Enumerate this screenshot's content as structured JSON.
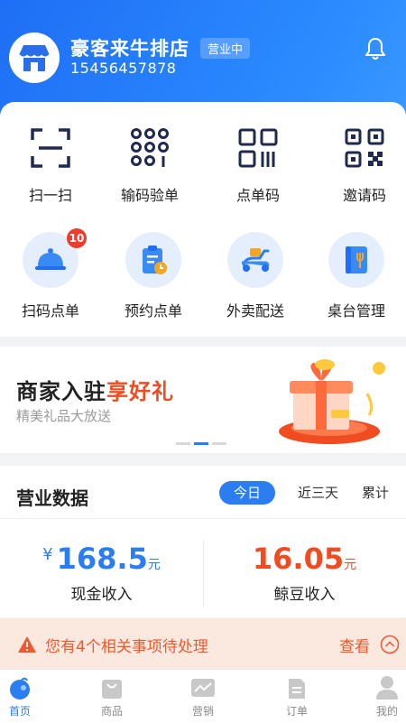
{
  "colors": {
    "primary": "#2b7ef2",
    "accent": "#f04c22",
    "notice_bg": "#fbe9e0"
  },
  "header": {
    "store_name": "豪客来牛排店",
    "status": "营业中",
    "phone": "15456457878",
    "avatar_icon": "storefront-icon",
    "bell_icon": "bell-icon"
  },
  "quick_actions": [
    {
      "label": "扫一扫",
      "icon": "scan-icon"
    },
    {
      "label": "输码验单",
      "icon": "code-grid-icon"
    },
    {
      "label": "点单码",
      "icon": "barcode-icon"
    },
    {
      "label": "邀请码",
      "icon": "qr-code-icon"
    }
  ],
  "services": [
    {
      "label": "扫码点单",
      "icon": "dish-cover-icon",
      "badge": "10"
    },
    {
      "label": "预约点单",
      "icon": "clipboard-clock-icon"
    },
    {
      "label": "外卖配送",
      "icon": "scooter-icon"
    },
    {
      "label": "桌台管理",
      "icon": "menu-book-icon"
    }
  ],
  "banner": {
    "title_prefix": "商家入驻",
    "title_highlight": "享好礼",
    "subtitle": "精美礼品大放送",
    "image_icon": "gift-box-icon"
  },
  "business": {
    "title": "营业数据",
    "tabs": [
      "今日",
      "近三天",
      "累计"
    ],
    "active_tab": 0,
    "cash": {
      "currency": "¥",
      "value": "168.5",
      "unit": "元",
      "label": "现金收入"
    },
    "beans": {
      "value": "16.05",
      "unit": "元",
      "label": "鲸豆收入"
    }
  },
  "notice": {
    "text": "您有4个相关事项待处理",
    "link": "查看"
  },
  "tabbar": [
    {
      "label": "首页",
      "icon": "home-icon",
      "active": true
    },
    {
      "label": "商品",
      "icon": "bag-icon",
      "active": false
    },
    {
      "label": "营销",
      "icon": "chart-icon",
      "active": false
    },
    {
      "label": "订单",
      "icon": "document-icon",
      "active": false
    },
    {
      "label": "我的",
      "icon": "user-icon",
      "active": false
    }
  ]
}
